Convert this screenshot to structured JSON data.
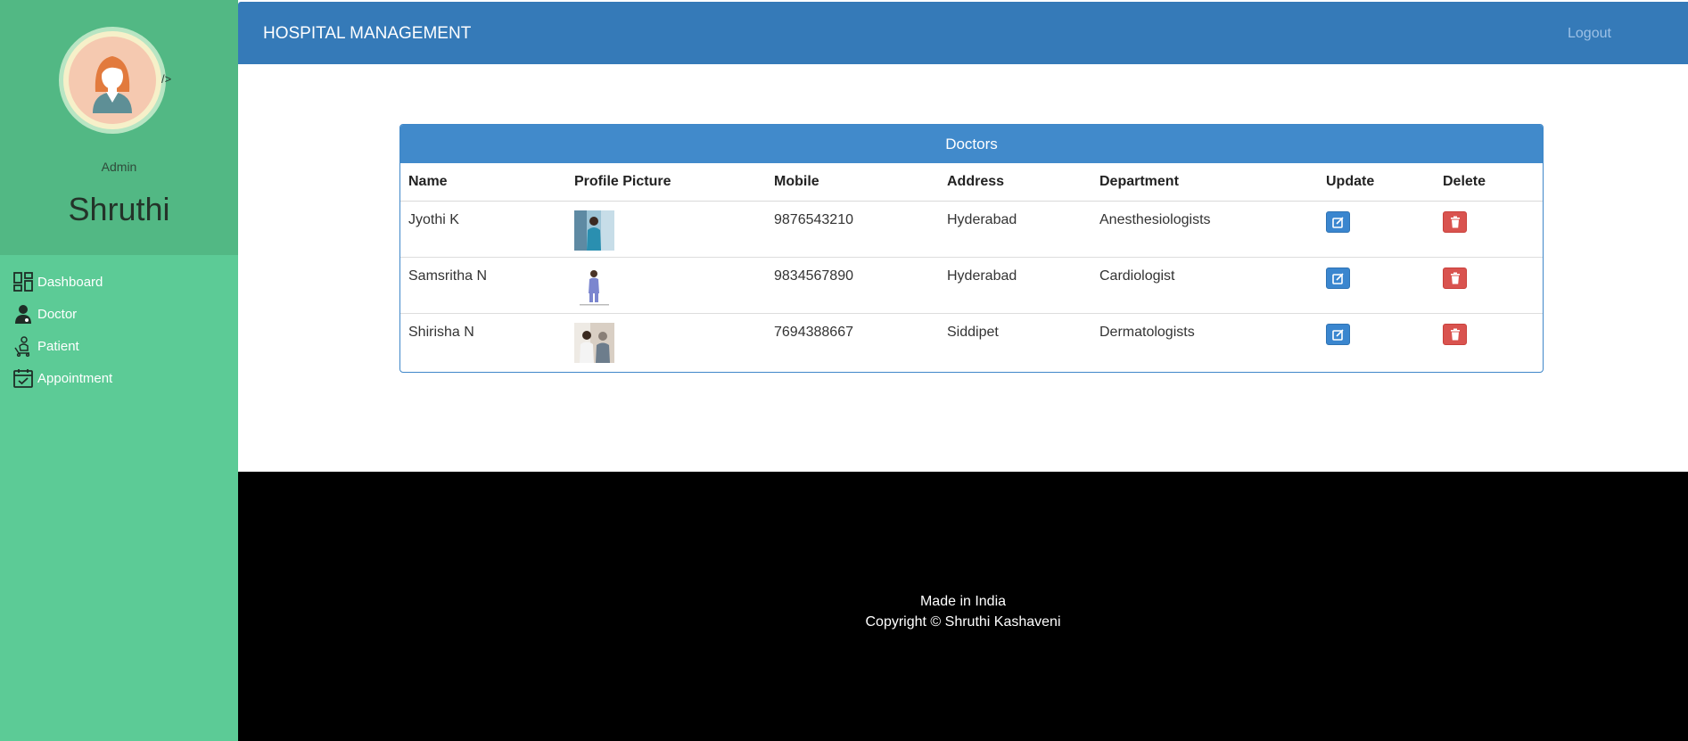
{
  "sidebar": {
    "stray_text": "/>",
    "role": "Admin",
    "user_name": "Shruthi",
    "items": [
      {
        "label": "Dashboard",
        "icon": "dashboard-icon"
      },
      {
        "label": "Doctor",
        "icon": "doctor-icon"
      },
      {
        "label": "Patient",
        "icon": "patient-icon"
      },
      {
        "label": "Appointment",
        "icon": "calendar-check-icon"
      }
    ]
  },
  "header": {
    "title": "HOSPITAL MANAGEMENT",
    "logout": "Logout"
  },
  "panel": {
    "title": "Doctors",
    "columns": [
      "Name",
      "Profile Picture",
      "Mobile",
      "Address",
      "Department",
      "Update",
      "Delete"
    ],
    "rows": [
      {
        "name": "Jyothi K",
        "mobile": "9876543210",
        "address": "Hyderabad",
        "department": "Anesthesiologists"
      },
      {
        "name": "Samsritha N",
        "mobile": "9834567890",
        "address": "Hyderabad",
        "department": "Cardiologist"
      },
      {
        "name": "Shirisha N",
        "mobile": "7694388667",
        "address": "Siddipet",
        "department": "Dermatologists"
      }
    ]
  },
  "footer": {
    "line1": "Made in India",
    "line2": "Copyright © Shruthi Kashaveni"
  },
  "colors": {
    "sidebar": "#5ccb96",
    "sidebar_profile": "#52b884",
    "header": "#357ab8",
    "panel_heading": "#418acb",
    "edit_button": "#3a86cf",
    "delete_button": "#d9534f",
    "footer": "#000000"
  }
}
